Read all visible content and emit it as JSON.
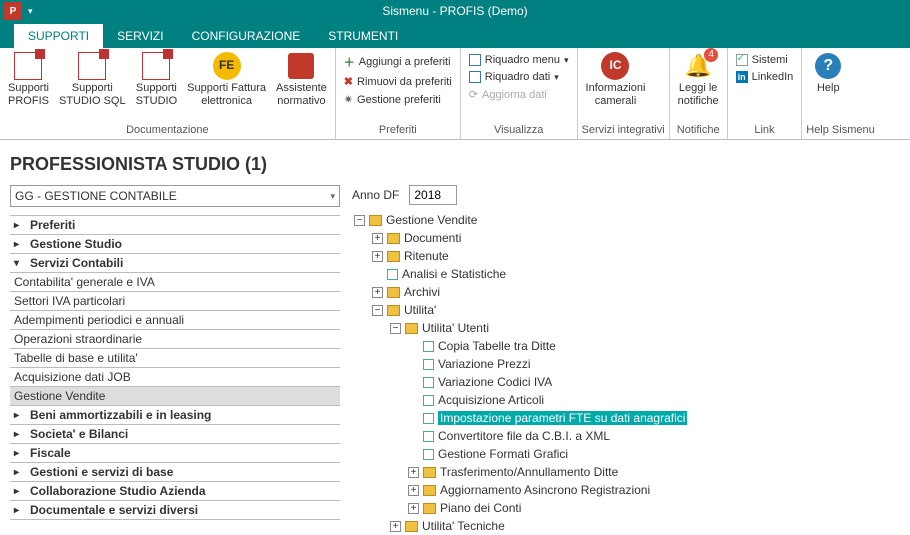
{
  "title_bar": {
    "app_title": "Sismenu - PROFIS  (Demo)"
  },
  "tabs": {
    "supporti": "SUPPORTI",
    "servizi": "SERVIZI",
    "config": "CONFIGURAZIONE",
    "strumenti": "STRUMENTI"
  },
  "ribbon": {
    "doc": {
      "supporti_profis": "Supporti\nPROFIS",
      "supporti_studio_sql": "Supporti\nSTUDIO SQL",
      "supporti_studio": "Supporti\nSTUDIO",
      "supporti_fattura": "Supporti Fattura\nelettronica",
      "assistente": "Assistente\nnormativo",
      "group": "Documentazione"
    },
    "preferiti": {
      "add": "Aggiungi a preferiti",
      "remove": "Rimuovi da preferiti",
      "manage": "Gestione preferiti",
      "group": "Preferiti"
    },
    "visualizza": {
      "menu": "Riquadro menu",
      "dati": "Riquadro dati",
      "aggiorna": "Aggiorna dati",
      "group": "Visualizza"
    },
    "servizi_int": {
      "info": "Informazioni\ncamerali",
      "group": "Servizi integrativi"
    },
    "notifiche": {
      "leggi": "Leggi le\nnotifiche",
      "badge": "4",
      "group": "Notifiche"
    },
    "link": {
      "sistemi": "Sistemi",
      "linkedin": "LinkedIn",
      "group": "Link"
    },
    "help": {
      "help": "Help",
      "group": "Help Sismenu"
    }
  },
  "heading": "PROFESSIONISTA STUDIO (1)",
  "combo": "GG - GESTIONE CONTABILE",
  "anno_label": "Anno DF",
  "anno_value": "2018",
  "accordion": {
    "preferiti": "Preferiti",
    "gestione_studio": "Gestione Studio",
    "servizi_contabili": "Servizi Contabili",
    "sc_sub": {
      "a": "Contabilita' generale e IVA",
      "b": "Settori IVA particolari",
      "c": "Adempimenti periodici e annuali",
      "d": "Operazioni straordinarie",
      "e": "Tabelle di base e utilita'",
      "f": "Acquisizione dati JOB",
      "g": "Gestione Vendite"
    },
    "beni": "Beni ammortizzabili e in leasing",
    "societa": "Societa' e Bilanci",
    "fiscale": "Fiscale",
    "gestioni": "Gestioni e servizi di base",
    "collab": "Collaborazione Studio Azienda",
    "documentale": "Documentale e servizi diversi"
  },
  "tree": {
    "gestione_vendite": "Gestione Vendite",
    "documenti": "Documenti",
    "ritenute": "Ritenute",
    "analisi": "Analisi e Statistiche",
    "archivi": "Archivi",
    "utilita": "Utilita'",
    "utilita_utenti": "Utilita' Utenti",
    "copia_tabelle": "Copia Tabelle tra Ditte",
    "variazione_prezzi": "Variazione Prezzi",
    "variazione_codici": "Variazione Codici IVA",
    "acquisizione_articoli": "Acquisizione Articoli",
    "impostazione_fte": "Impostazione parametri FTE su dati anagrafici",
    "convertitore": "Convertitore file da C.B.I. a XML",
    "gestione_formati": "Gestione Formati Grafici",
    "trasferimento": "Trasferimento/Annullamento Ditte",
    "aggiorn_async": "Aggiornamento Asincrono Registrazioni",
    "piano_conti": "Piano dei Conti",
    "utilita_tecniche": "Utilita' Tecniche"
  }
}
